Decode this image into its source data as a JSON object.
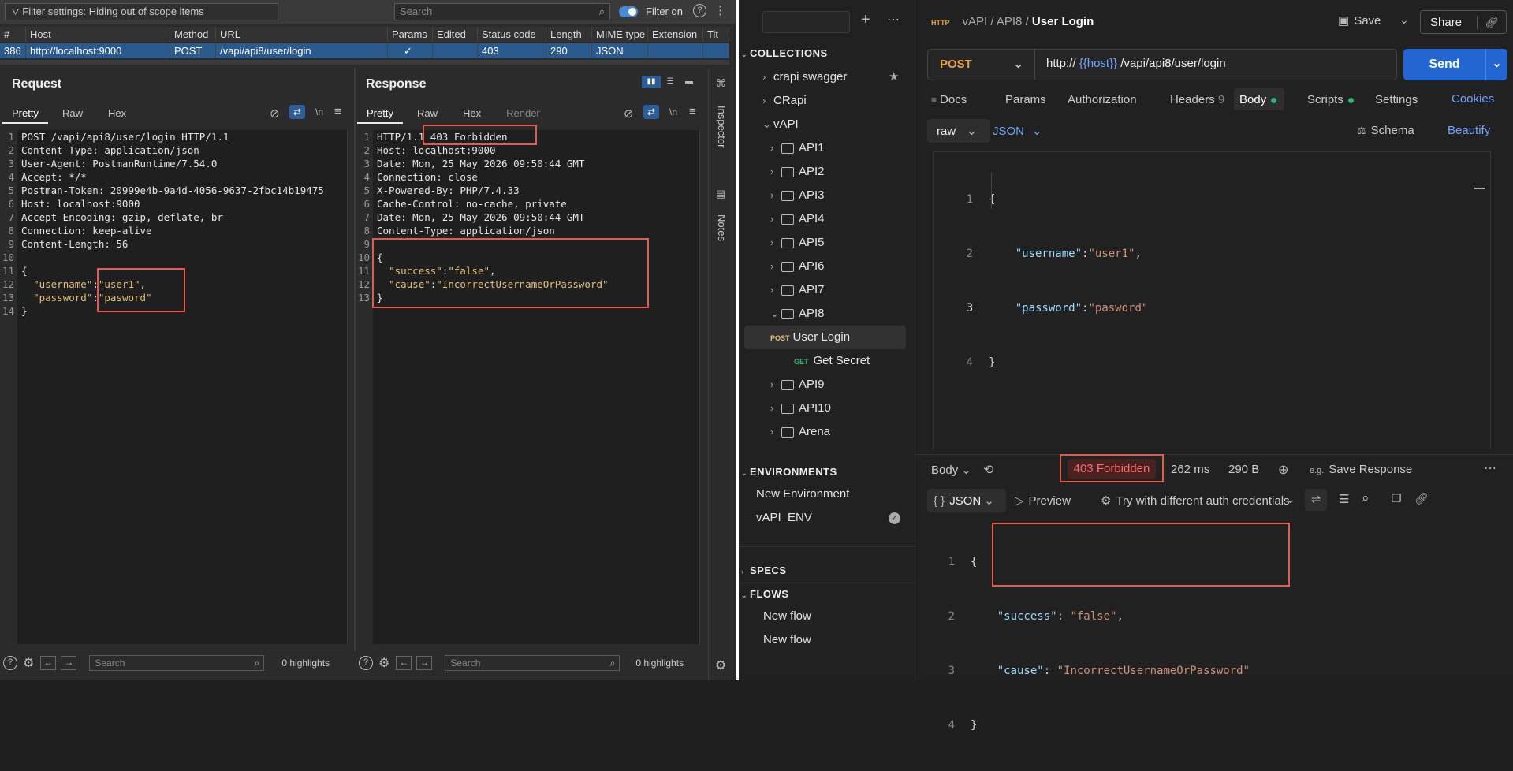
{
  "burp": {
    "filter_label": "Filter settings: Hiding out of scope items",
    "search_placeholder": "Search",
    "filter_on_label": "Filter on",
    "history_columns": [
      "#",
      "Host",
      "Method",
      "URL",
      "Params",
      "Edited",
      "Status code",
      "Length",
      "MIME type",
      "Extension",
      "Tit"
    ],
    "history_row": [
      "386",
      "http://localhost:9000",
      "POST",
      "/vapi/api8/user/login",
      "✓",
      "",
      "403",
      "290",
      "JSON",
      "",
      ""
    ],
    "request": {
      "title": "Request",
      "tabs": [
        "Pretty",
        "Raw",
        "Hex"
      ],
      "newline_label": "\\n",
      "lines": [
        "POST /vapi/api8/user/login HTTP/1.1",
        "Content-Type: application/json",
        "User-Agent: PostmanRuntime/7.54.0",
        "Accept: */*",
        "Postman-Token: 20999e4b-9a4d-4056-9637-2fbc14b19475",
        "Host: localhost:9000",
        "Accept-Encoding: gzip, deflate, br",
        "Connection: keep-alive",
        "Content-Length: 56",
        "",
        "{",
        "  \"username\":\"user1\",",
        "  \"password\":\"pasword\"",
        "}"
      ],
      "highlights": "0 highlights"
    },
    "response": {
      "title": "Response",
      "tabs": [
        "Pretty",
        "Raw",
        "Hex",
        "Render"
      ],
      "newline_label": "\\n",
      "lines": [
        "HTTP/1.1 403 Forbidden",
        "Host: localhost:9000",
        "Date: Mon, 25 May 2026 09:50:44 GMT",
        "Connection: close",
        "X-Powered-By: PHP/7.4.33",
        "Cache-Control: no-cache, private",
        "Date: Mon, 25 May 2026 09:50:44 GMT",
        "Content-Type: application/json",
        "",
        "{",
        "  \"success\":\"false\",",
        "  \"cause\":\"IncorrectUsernameOrPassword\"",
        "}"
      ],
      "highlights": "0 highlights"
    },
    "side_tabs": [
      "Inspector",
      "Notes"
    ]
  },
  "postman": {
    "sidebar": {
      "collections_label": "COLLECTIONS",
      "collections": [
        {
          "label": "crapi swagger",
          "starred": true
        },
        {
          "label": "CRapi"
        },
        {
          "label": "vAPI",
          "expanded": true
        }
      ],
      "folders": [
        "API1",
        "API2",
        "API3",
        "API4",
        "API5",
        "API6",
        "API7",
        "API8"
      ],
      "api8_requests": [
        {
          "method": "POST",
          "label": "User Login"
        },
        {
          "method": "GET",
          "label": "Get Secret"
        }
      ],
      "folders_after": [
        "API9",
        "API10",
        "Arena"
      ],
      "environments_label": "ENVIRONMENTS",
      "environments": [
        "New Environment",
        "vAPI_ENV"
      ],
      "specs_label": "SPECS",
      "flows_label": "FLOWS",
      "flows": [
        "New flow",
        "New flow"
      ]
    },
    "breadcrumb": [
      "vAPI",
      "API8",
      "User Login"
    ],
    "save_label": "Save",
    "share_label": "Share",
    "method": "POST",
    "url_prefix": "http://",
    "url_var": "{{host}}",
    "url_path": "/vapi/api8/user/login",
    "send_label": "Send",
    "tabs": [
      "Docs",
      "Params",
      "Authorization",
      "Headers",
      "Body",
      "Scripts",
      "Settings"
    ],
    "headers_count": "9",
    "cookies_label": "Cookies",
    "body_mode": "raw",
    "body_lang": "JSON",
    "schema_label": "Schema",
    "beautify_label": "Beautify",
    "request_body": {
      "line_numbers": [
        "1",
        "2",
        "3",
        "4"
      ],
      "open": "{",
      "username_key": "\"username\"",
      "username_val": "\"user1\"",
      "password_key": "\"password\"",
      "password_val": "\"pasword\"",
      "close": "}"
    },
    "response_bar": {
      "body_label": "Body",
      "status": "403 Forbidden",
      "time": "262 ms",
      "size": "290 B",
      "save_response_label": "Save Response"
    },
    "response_view": {
      "format": "JSON",
      "preview_label": "Preview",
      "auth_label": "Try with different auth credentials"
    },
    "response_body": {
      "line_numbers": [
        "1",
        "2",
        "3",
        "4"
      ],
      "open": "{",
      "success_key": "\"success\"",
      "success_val": "\"false\"",
      "cause_key": "\"cause\"",
      "cause_val": "\"IncorrectUsernameOrPassword\"",
      "close": "}"
    }
  }
}
